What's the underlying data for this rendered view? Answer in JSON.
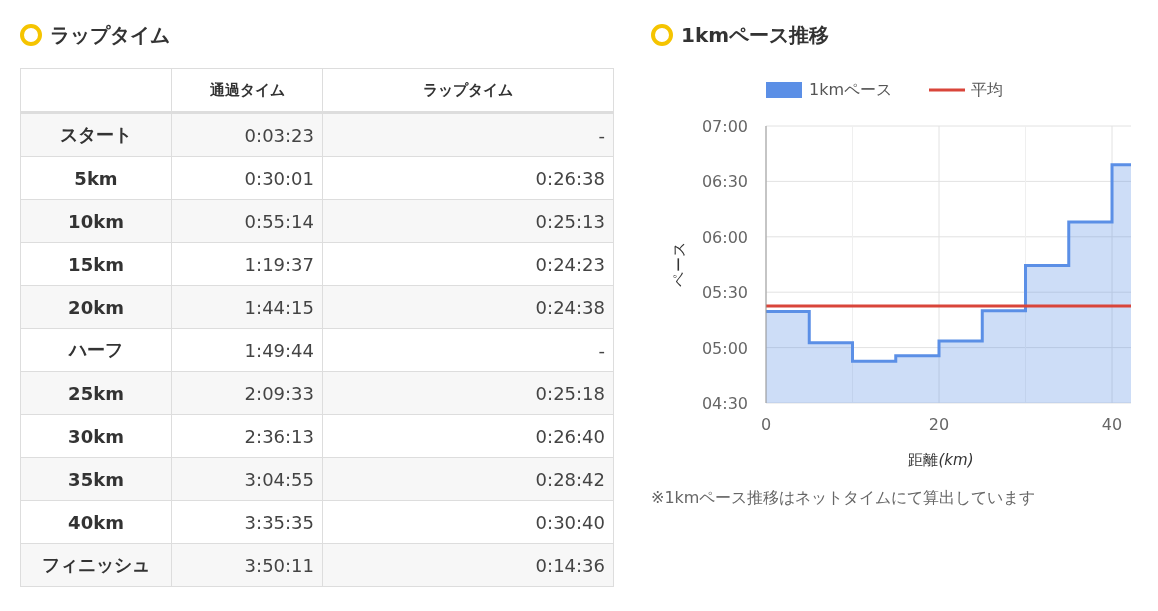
{
  "lap_section": {
    "title": "ラップタイム",
    "columns": [
      "",
      "通過タイム",
      "ラップタイム"
    ],
    "rows": [
      [
        "スタート",
        "0:03:23",
        "-"
      ],
      [
        "5km",
        "0:30:01",
        "0:26:38"
      ],
      [
        "10km",
        "0:55:14",
        "0:25:13"
      ],
      [
        "15km",
        "1:19:37",
        "0:24:23"
      ],
      [
        "20km",
        "1:44:15",
        "0:24:38"
      ],
      [
        "ハーフ",
        "1:49:44",
        "-"
      ],
      [
        "25km",
        "2:09:33",
        "0:25:18"
      ],
      [
        "30km",
        "2:36:13",
        "0:26:40"
      ],
      [
        "35km",
        "3:04:55",
        "0:28:42"
      ],
      [
        "40km",
        "3:35:35",
        "0:30:40"
      ],
      [
        "フィニッシュ",
        "3:50:11",
        "0:14:36"
      ]
    ]
  },
  "pace_section": {
    "title": "1kmペース推移",
    "chart_data": {
      "type": "area",
      "xlabel": "距離(km)",
      "ylabel": "ペース",
      "grid": true,
      "legend": "top",
      "x": [
        0,
        5,
        5,
        10,
        10,
        15,
        15,
        20,
        20,
        25,
        25,
        30,
        30,
        35,
        35,
        40,
        40,
        42.195
      ],
      "series": [
        {
          "name": "1kmペース",
          "type": "area",
          "color": "#5b8fe6",
          "values": [
            319.6,
            319.6,
            302.6,
            302.6,
            292.6,
            292.6,
            295.6,
            295.6,
            303.6,
            303.6,
            320,
            320,
            344.4,
            344.4,
            368,
            368,
            399,
            399
          ]
        },
        {
          "name": "平均",
          "type": "line",
          "color": "#d9453a",
          "values": [
            322.5,
            322.5,
            322.5,
            322.5,
            322.5,
            322.5,
            322.5,
            322.5,
            322.5,
            322.5,
            322.5,
            322.5,
            322.5,
            322.5,
            322.5,
            322.5,
            322.5,
            322.5
          ]
        }
      ],
      "xlim": [
        0,
        42.195
      ],
      "ylim": [
        270,
        420
      ],
      "xticks": [
        0,
        20,
        40
      ],
      "ref_lines": [
        {
          "axis": "x",
          "value": 10
        },
        {
          "axis": "x",
          "value": 30
        }
      ],
      "yticks": [
        {
          "value": 270,
          "label": "04:30"
        },
        {
          "value": 300,
          "label": "05:00"
        },
        {
          "value": 330,
          "label": "05:30"
        },
        {
          "value": 360,
          "label": "06:00"
        },
        {
          "value": 390,
          "label": "06:30"
        },
        {
          "value": 420,
          "label": "07:00"
        }
      ]
    },
    "note": "※1kmペース推移はネットタイムにて算出しています"
  }
}
